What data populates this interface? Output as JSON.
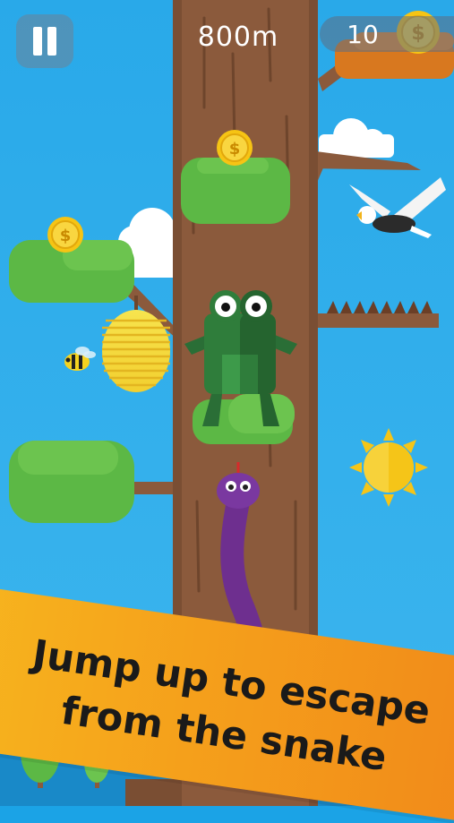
{
  "hud": {
    "distance": "800m",
    "coins": "10",
    "pause_icon": "pause-icon",
    "coin_icon": "coin-icon"
  },
  "banner": {
    "line1": "Jump up to escape",
    "line2": "from the snake"
  },
  "colors": {
    "sky": "#1ba3e6",
    "trunk": "#8b5a3c",
    "leaf": "#5cb845",
    "coin": "#f6c414",
    "snake": "#6e2f8f",
    "frog": "#2f7d3b",
    "banner": "#f5a01b"
  }
}
